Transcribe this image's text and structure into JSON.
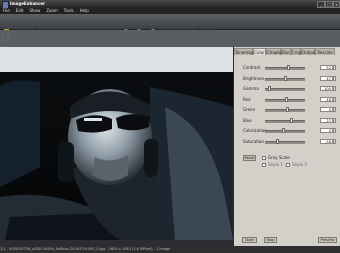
{
  "window": {
    "title": "ImageEnhancer"
  },
  "menu": [
    "File",
    "Edit",
    "Show",
    "Zoom",
    "Tools",
    "Help"
  ],
  "tabs": [
    "Tonemapping",
    "Color",
    "Chapter",
    "Blur",
    "Crop",
    "Output",
    "Rescale"
  ],
  "active_tab": 1,
  "sliders": [
    {
      "label": "Contrast",
      "value": "52",
      "level": 0.58
    },
    {
      "label": "Brightness",
      "value": "47",
      "level": 0.5
    },
    {
      "label": "Gamma",
      "value": "100",
      "level": 0.1
    },
    {
      "label": "Red",
      "value": "48",
      "level": 0.52
    },
    {
      "label": "Green",
      "value": "0",
      "level": 0.56
    },
    {
      "label": "Blue",
      "value": "27",
      "level": 0.64
    },
    {
      "label": "Colorization",
      "value": "0",
      "level": 0.45
    },
    {
      "label": "Saturation",
      "value": "-56",
      "level": 0.3
    }
  ],
  "options": {
    "reset_label": "Reset",
    "gray_scale_label": "Gray Scale",
    "sepia1_label": "Sepia 1",
    "sepia2_label": "Sepia 2"
  },
  "bottom_buttons": {
    "start": "Start",
    "stop": "Stop",
    "preview": "Preview"
  },
  "status": "1/1 - 00/5030758_x/DSC04494_Softbox-2009-P19-092_0.jpg - 1600 x 1063 (1.6 MPixel) - 1 Image"
}
